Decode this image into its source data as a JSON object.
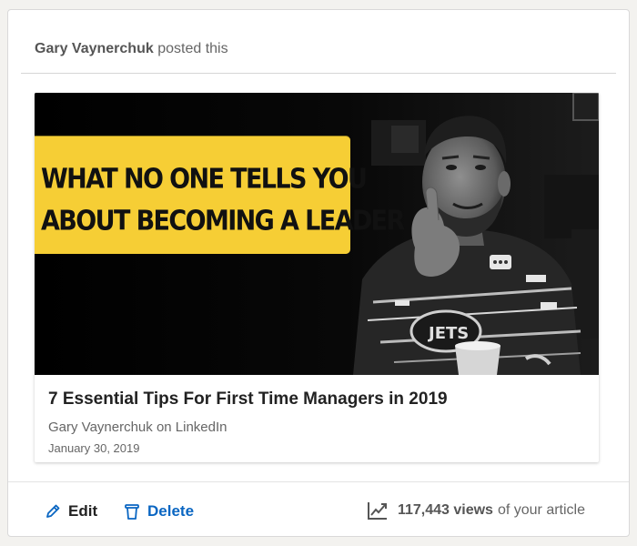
{
  "post": {
    "author": "Gary Vaynerchuk",
    "action_text": "posted this"
  },
  "article": {
    "image": {
      "banner_line1": "WHAT NO ONE TELLS YOU",
      "banner_line2": "ABOUT BECOMING A LEADER",
      "banner_color": "#f6ce35",
      "description_icon": "person-photo"
    },
    "title": "7 Essential Tips For First Time Managers in 2019",
    "source": "Gary Vaynerchuk on LinkedIn",
    "date": "January 30, 2019"
  },
  "footer": {
    "edit_label": "Edit",
    "edit_icon": "pencil-icon",
    "delete_label": "Delete",
    "delete_icon": "trash-icon",
    "views_icon": "trending-up-chart-icon",
    "views_count": "117,443 views",
    "views_suffix": "of your article",
    "accent_color": "#0a66c2"
  }
}
